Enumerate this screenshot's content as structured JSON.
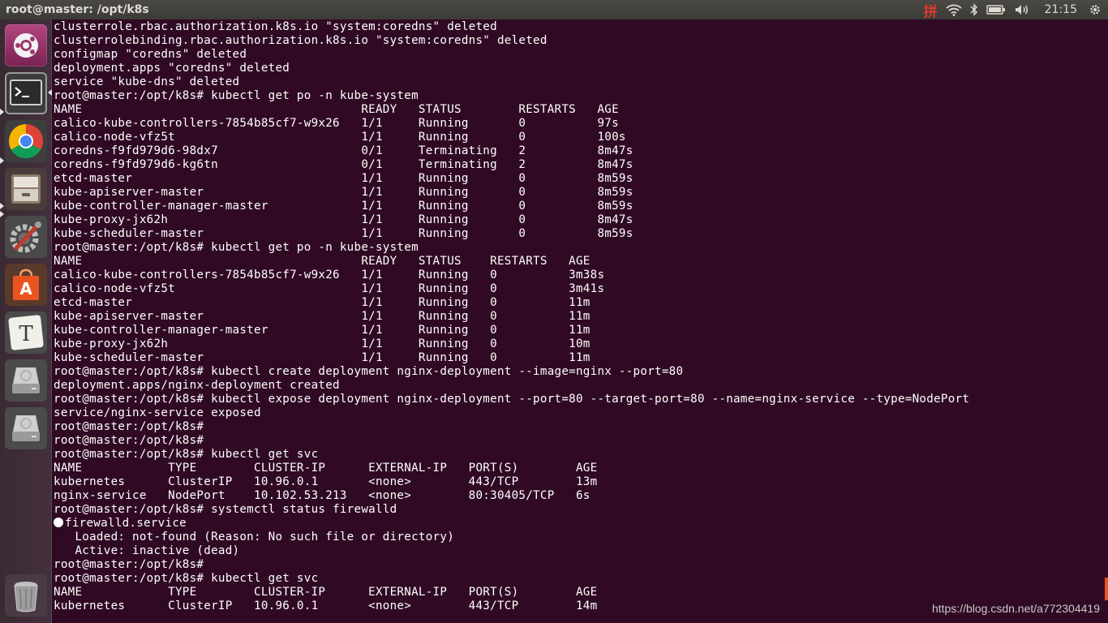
{
  "window": {
    "title": "root@master: /opt/k8s"
  },
  "panel": {
    "ime_label": "拼",
    "clock": "21:15",
    "icons": [
      "ime-icon",
      "wifi-icon",
      "bluetooth-icon",
      "battery-icon",
      "volume-icon",
      "gear-icon"
    ]
  },
  "launcher": {
    "items": [
      {
        "name": "ubuntu-dash-icon"
      },
      {
        "name": "terminal-icon"
      },
      {
        "name": "chrome-icon"
      },
      {
        "name": "files-icon"
      },
      {
        "name": "system-settings-icon"
      },
      {
        "name": "software-center-icon"
      },
      {
        "name": "text-editor-icon"
      },
      {
        "name": "drive-icon"
      },
      {
        "name": "drive-icon"
      },
      {
        "name": "trash-icon"
      }
    ]
  },
  "terminal": {
    "lines": [
      "clusterrole.rbac.authorization.k8s.io \"system:coredns\" deleted",
      "clusterrolebinding.rbac.authorization.k8s.io \"system:coredns\" deleted",
      "configmap \"coredns\" deleted",
      "deployment.apps \"coredns\" deleted",
      "service \"kube-dns\" deleted",
      "root@master:/opt/k8s# kubectl get po -n kube-system",
      "NAME                                       READY   STATUS        RESTARTS   AGE",
      "calico-kube-controllers-7854b85cf7-w9x26   1/1     Running       0          97s",
      "calico-node-vfz5t                          1/1     Running       0          100s",
      "coredns-f9fd979d6-98dx7                    0/1     Terminating   2          8m47s",
      "coredns-f9fd979d6-kg6tn                    0/1     Terminating   2          8m47s",
      "etcd-master                                1/1     Running       0          8m59s",
      "kube-apiserver-master                      1/1     Running       0          8m59s",
      "kube-controller-manager-master             1/1     Running       0          8m59s",
      "kube-proxy-jx62h                           1/1     Running       0          8m47s",
      "kube-scheduler-master                      1/1     Running       0          8m59s",
      "root@master:/opt/k8s# kubectl get po -n kube-system",
      "NAME                                       READY   STATUS    RESTARTS   AGE",
      "calico-kube-controllers-7854b85cf7-w9x26   1/1     Running   0          3m38s",
      "calico-node-vfz5t                          1/1     Running   0          3m41s",
      "etcd-master                                1/1     Running   0          11m",
      "kube-apiserver-master                      1/1     Running   0          11m",
      "kube-controller-manager-master             1/1     Running   0          11m",
      "kube-proxy-jx62h                           1/1     Running   0          10m",
      "kube-scheduler-master                      1/1     Running   0          11m",
      "root@master:/opt/k8s# kubectl create deployment nginx-deployment --image=nginx --port=80",
      "deployment.apps/nginx-deployment created",
      "root@master:/opt/k8s# kubectl expose deployment nginx-deployment --port=80 --target-port=80 --name=nginx-service --type=NodePort",
      "service/nginx-service exposed",
      "root@master:/opt/k8s#",
      "root@master:/opt/k8s#",
      "root@master:/opt/k8s# kubectl get svc",
      "NAME            TYPE        CLUSTER-IP      EXTERNAL-IP   PORT(S)        AGE",
      "kubernetes      ClusterIP   10.96.0.1       <none>        443/TCP        13m",
      "nginx-service   NodePort    10.102.53.213   <none>        80:30405/TCP   6s",
      "root@master:/opt/k8s# systemctl status firewalld",
      "firewalld.service",
      "   Loaded: not-found (Reason: No such file or directory)",
      "   Active: inactive (dead)",
      "root@master:/opt/k8s#",
      "root@master:/opt/k8s# kubectl get svc",
      "NAME            TYPE        CLUSTER-IP      EXTERNAL-IP   PORT(S)        AGE",
      "kubernetes      ClusterIP   10.96.0.1       <none>        443/TCP        14m"
    ]
  },
  "watermark": "https://blog.csdn.net/a772304419",
  "colors": {
    "terminal_bg": "#300a24",
    "panel_bg": "#3c3b37",
    "accent": "#e95420",
    "ime": "#e0392b"
  }
}
